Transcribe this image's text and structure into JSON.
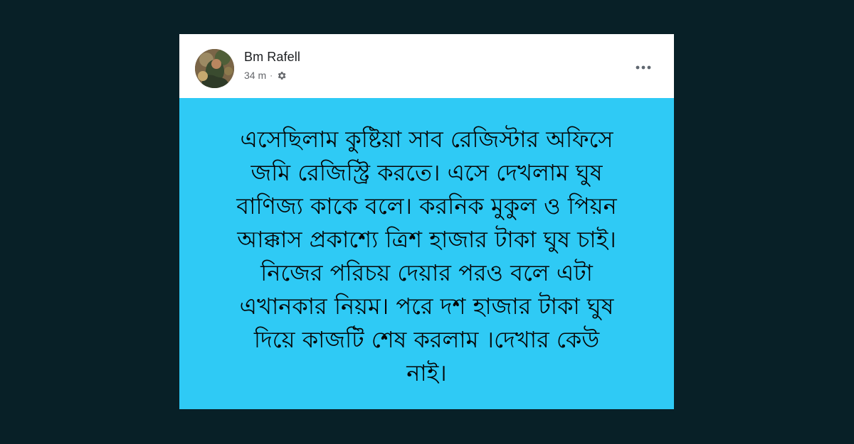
{
  "post": {
    "author": "Bm Rafell",
    "timestamp": "34 m",
    "separator": "·",
    "privacy_icon": "gear-icon",
    "more_icon": "more-options-icon",
    "text": "এসেছিলাম কুষ্টিয়া সাব রেজিস্টার অফিসে\nজমি রেজিস্ট্রি করতে। এসে দেখলাম ঘুষ\nবাণিজ্য কাকে বলে। করনিক মুকুল ও পিয়ন\nআক্কাস প্রকাশ্যে ত্রিশ হাজার টাকা ঘুষ চাই।\nনিজের পরিচয় দেয়ার পরও বলে এটা\nএখানকার নিয়ম। পরে দশ হাজার টাকা ঘুষ\nদিয়ে কাজটি শেষ করলাম ।দেখার কেউ\nনাই।",
    "background_color": "#2fcaf5"
  }
}
